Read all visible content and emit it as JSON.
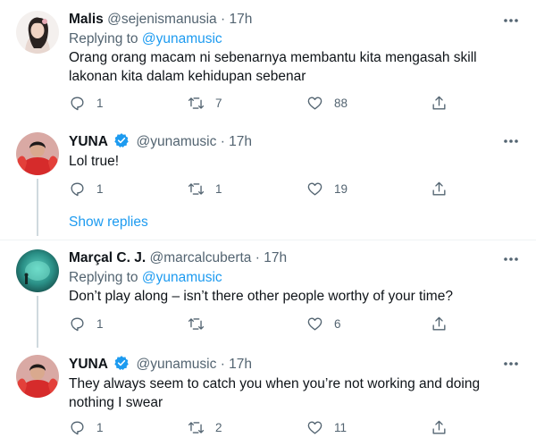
{
  "colors": {
    "accent": "#1d9bf0",
    "muted": "#536471",
    "text": "#0f1419"
  },
  "tweets": [
    {
      "name": "Malis",
      "handle": "@sejenismanusia",
      "separator": "·",
      "time": "17h",
      "verified": false,
      "replying_prefix": "Replying to",
      "replying_to": "@yunamusic",
      "text": "Orang orang macam ni sebenarnya membantu kita mengasah skill lakonan kita dalam kehidupan sebenar",
      "replies": "1",
      "retweets": "7",
      "likes": "88"
    },
    {
      "name": "YUNA",
      "handle": "@yunamusic",
      "separator": "·",
      "time": "17h",
      "verified": true,
      "text": "Lol true!",
      "replies": "1",
      "retweets": "1",
      "likes": "19"
    },
    {
      "name": "Marçal C. J.",
      "handle": "@marcalcuberta",
      "separator": "·",
      "time": "17h",
      "verified": false,
      "replying_prefix": "Replying to",
      "replying_to": "@yunamusic",
      "text": "Don’t play along – isn’t there other people worthy of your time?",
      "replies": "1",
      "retweets": "",
      "likes": "6"
    },
    {
      "name": "YUNA",
      "handle": "@yunamusic",
      "separator": "·",
      "time": "17h",
      "verified": true,
      "text": "They always seem to catch you when you’re not working and doing nothing I swear",
      "replies": "1",
      "retweets": "2",
      "likes": "11"
    }
  ],
  "show_replies": "Show replies"
}
